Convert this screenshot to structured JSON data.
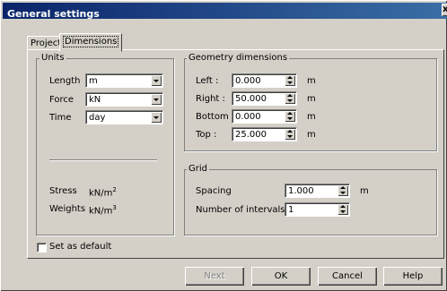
{
  "window": {
    "title": "General settings",
    "close_glyph": "x"
  },
  "tabs": [
    {
      "label": "Project",
      "active": false
    },
    {
      "label": "Dimensions",
      "active": true
    }
  ],
  "units": {
    "title": "Units",
    "length": {
      "label": "Length",
      "value": "m"
    },
    "force": {
      "label": "Force",
      "value": "kN"
    },
    "time": {
      "label": "Time",
      "value": "day"
    },
    "stress": {
      "label": "Stress",
      "unit": "kN/m",
      "exp": "2"
    },
    "weights": {
      "label": "Weights",
      "unit": "kN/m",
      "exp": "3"
    }
  },
  "geometry": {
    "title": "Geometry dimensions",
    "left": {
      "label": "Left :",
      "value": "0.000",
      "unit": "m"
    },
    "right": {
      "label": "Right :",
      "value": "50.000",
      "unit": "m"
    },
    "bottom": {
      "label": "Bottom :",
      "value": "0.000",
      "unit": "m"
    },
    "top": {
      "label": "Top :",
      "value": "25.000",
      "unit": "m"
    }
  },
  "grid": {
    "title": "Grid",
    "spacing": {
      "label": "Spacing",
      "value": "1.000",
      "unit": "m"
    },
    "intervals": {
      "label": "Number of intervals",
      "value": "1"
    }
  },
  "set_default": {
    "label": "Set as default",
    "checked": false
  },
  "buttons": {
    "next": "Next",
    "ok": "OK",
    "cancel": "Cancel",
    "help": "Help"
  },
  "colors": {
    "face": "#d4d0c8",
    "title_start": "#0a246a",
    "title_end": "#3a6ea5"
  },
  "icons": [
    "close-icon",
    "dropdown-arrow-icon",
    "spin-arrows-icon"
  ]
}
